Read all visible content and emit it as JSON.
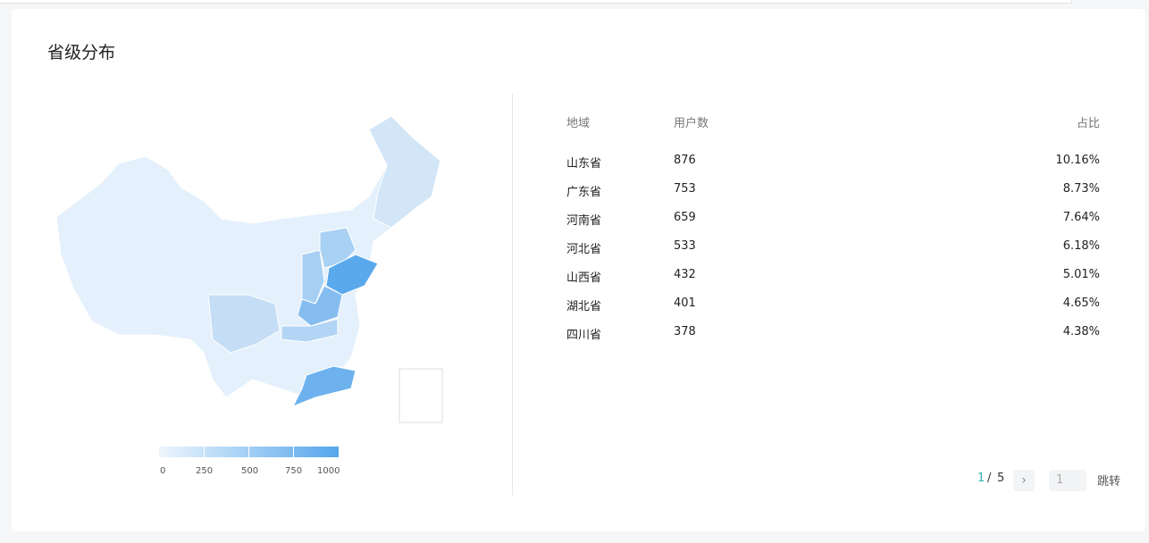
{
  "title": "省级分布",
  "legend": {
    "ticks": [
      "0",
      "250",
      "500",
      "750",
      "1000"
    ],
    "min_color": "#eef6fd",
    "max_color": "#55a6ec"
  },
  "table": {
    "headers": [
      "地域",
      "用户数",
      "占比"
    ],
    "rows": [
      {
        "region": "山东省",
        "users": "876",
        "pct": "10.16%"
      },
      {
        "region": "广东省",
        "users": "753",
        "pct": "8.73%"
      },
      {
        "region": "河南省",
        "users": "659",
        "pct": "7.64%"
      },
      {
        "region": "河北省",
        "users": "533",
        "pct": "6.18%"
      },
      {
        "region": "山西省",
        "users": "432",
        "pct": "5.01%"
      },
      {
        "region": "湖北省",
        "users": "401",
        "pct": "4.65%"
      },
      {
        "region": "四川省",
        "users": "378",
        "pct": "4.38%"
      }
    ]
  },
  "pagination": {
    "current": "1",
    "separator": "/",
    "total": "5",
    "next_icon": "chevron-right-icon",
    "jump_value": "1",
    "jump_label": "跳转"
  },
  "accent": "#2bb5a8"
}
